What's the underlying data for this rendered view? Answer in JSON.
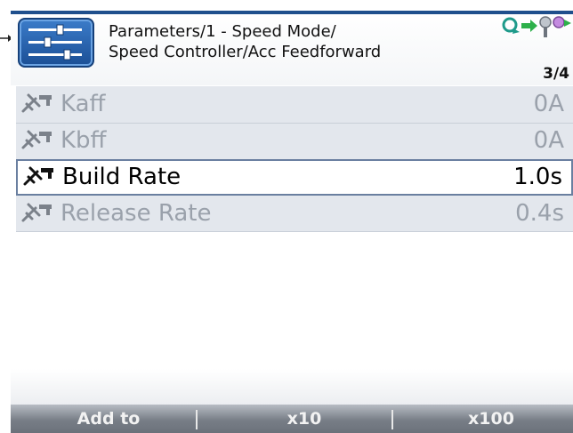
{
  "header": {
    "breadcrumb": "Parameters/1 - Speed Mode/\nSpeed Controller/Acc Feedforward",
    "page_indicator": "3/4",
    "app_icon": "parameter-sliders-icon",
    "status_icons": [
      "network-refresh-icon",
      "keys-icon"
    ]
  },
  "parameters": [
    {
      "name": "Kaff",
      "value": "0A",
      "state": "disabled",
      "icon": "wrench-parameter-icon"
    },
    {
      "name": "Kbff",
      "value": "0A",
      "state": "disabled",
      "icon": "wrench-parameter-icon"
    },
    {
      "name": "Build Rate",
      "value": "1.0s",
      "state": "selected",
      "icon": "wrench-parameter-icon"
    },
    {
      "name": "Release Rate",
      "value": "0.4s",
      "state": "disabled",
      "icon": "wrench-parameter-icon"
    }
  ],
  "softkeys": {
    "add_to": "Add to",
    "x10": "x10",
    "x100": "x100"
  },
  "colors": {
    "header_line": "#1f4f8c",
    "list_background": "#e3e7ed",
    "selected_border": "#6a7fa0",
    "muted_text": "#9aa1ab",
    "softkey_bar": "#787e87"
  }
}
